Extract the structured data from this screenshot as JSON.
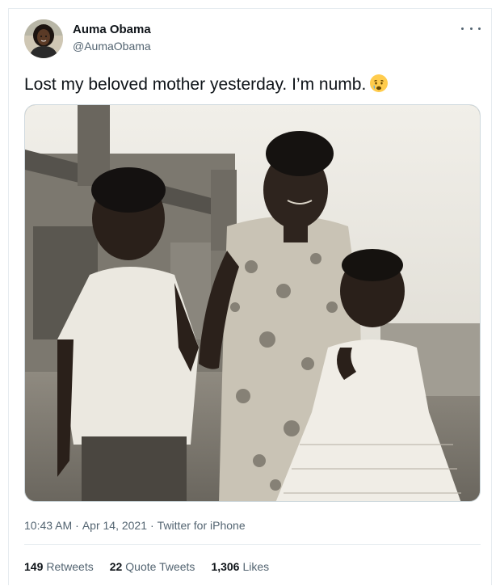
{
  "tweet": {
    "author": {
      "display_name": "Auma Obama",
      "handle": "@AumaObama"
    },
    "text": "Lost my beloved mother yesterday. I’m numb.",
    "emoji": "crying-face-emoji",
    "media": {
      "type": "photo",
      "tone": "black-and-white"
    },
    "time": "10:43 AM",
    "date": "Apr 14, 2021",
    "separator": "·",
    "source": "Twitter for iPhone",
    "stats": {
      "retweets_count": "149",
      "retweets_label": "Retweets",
      "quote_count": "22",
      "quote_label": "Quote Tweets",
      "likes_count": "1,306",
      "likes_label": "Likes"
    }
  },
  "icons": {
    "more": "more-horizontal-icon"
  },
  "colors": {
    "text_primary": "#0f1419",
    "text_secondary": "#536471",
    "border": "#e6ecf0"
  }
}
